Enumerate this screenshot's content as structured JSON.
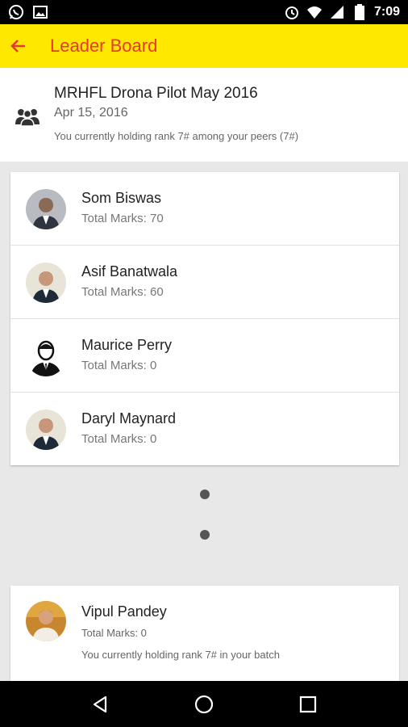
{
  "status_bar": {
    "time": "7:09",
    "icons_left": [
      "whatsapp-icon",
      "image-icon"
    ],
    "icons_right": [
      "alarm-icon",
      "wifi-icon",
      "signal-icon",
      "battery-icon"
    ]
  },
  "app_bar": {
    "title": "Leader Board",
    "back_icon": "arrow-left-icon",
    "background": "#ffe800",
    "title_color": "#e53935"
  },
  "header": {
    "title": "MRHFL Drona Pilot May 2016",
    "date": "Apr 15, 2016",
    "rank_text": "You currently holding rank 7# among your peers (7#)",
    "icon": "group-icon"
  },
  "leaders": [
    {
      "name": "Som Biswas",
      "marks": "Total Marks: 70",
      "avatar": "photo"
    },
    {
      "name": "Asif Banatwala",
      "marks": "Total Marks: 60",
      "avatar": "photo"
    },
    {
      "name": "Maurice Perry",
      "marks": "Total Marks: 0",
      "avatar": "placeholder-person-icon"
    },
    {
      "name": "Daryl Maynard",
      "marks": "Total Marks: 0",
      "avatar": "photo"
    }
  ],
  "current_user": {
    "name": "Vipul Pandey",
    "marks": "Total Marks: 0",
    "rank_text": "You currently holding rank 7# in your batch"
  },
  "nav_bar": {
    "icons": [
      "back-triangle-icon",
      "home-circle-icon",
      "recents-square-icon"
    ]
  }
}
